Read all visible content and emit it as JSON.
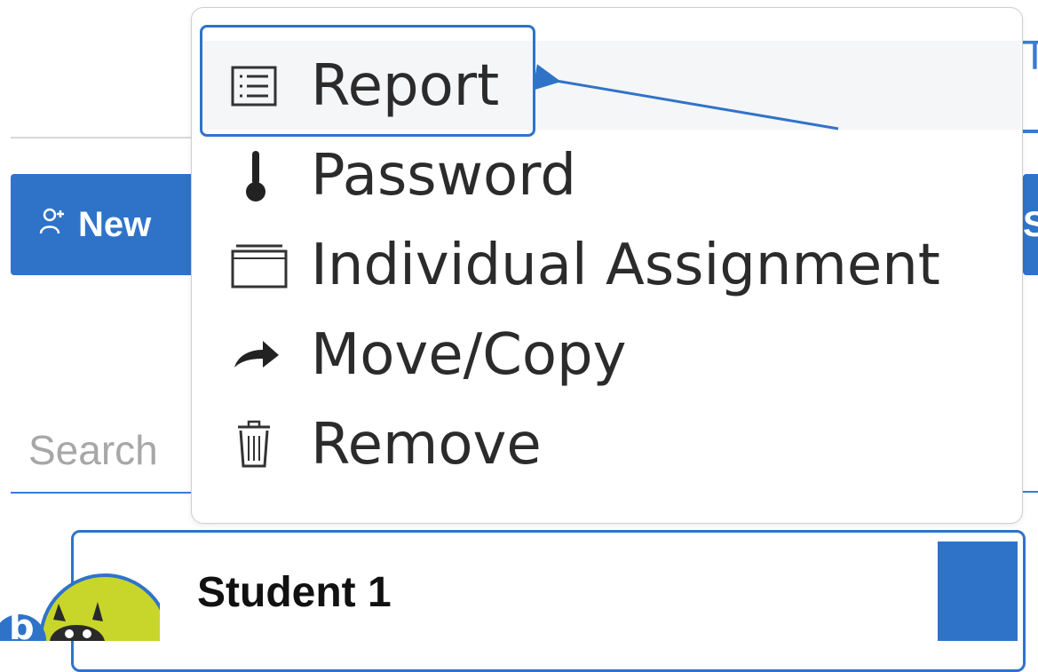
{
  "toolbar": {
    "new_label": "New",
    "partial_right_btn": "S"
  },
  "header": {
    "partial_right_text": "T"
  },
  "search": {
    "placeholder": "Search"
  },
  "student": {
    "name": "Student 1"
  },
  "menu": {
    "items": [
      {
        "label": "Report",
        "icon": "list-icon"
      },
      {
        "label": "Password",
        "icon": "thermometer-icon"
      },
      {
        "label": "Individual Assignment",
        "icon": "folder-icon"
      },
      {
        "label": "Move/Copy",
        "icon": "share-arrow-icon"
      },
      {
        "label": "Remove",
        "icon": "trash-icon"
      }
    ]
  },
  "colors": {
    "accent": "#2f73c9",
    "annotation": "#2f73c9"
  }
}
